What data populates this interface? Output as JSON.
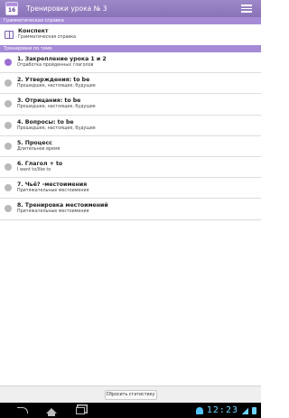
{
  "action_bar": {
    "app_icon_number": "16",
    "title": "Тренировки урока № 3"
  },
  "sections": {
    "grammar_header": "Грамматическая справка",
    "trainings_header": "Тренировки по теме"
  },
  "reference": {
    "title": "Конспект",
    "subtitle": "Грамматическая справка"
  },
  "lessons": [
    {
      "title": "1. Закрепление урока 1 и 2",
      "subtitle": "Отработка пройденных глаголов",
      "active": true
    },
    {
      "title": "2. Утверждения: to be",
      "subtitle": "Прошедшее, настоящее, будущее",
      "active": false
    },
    {
      "title": "3. Отрицания: to be",
      "subtitle": "Прошедшее, настоящее, будущее",
      "active": false
    },
    {
      "title": "4. Вопросы: to be",
      "subtitle": "Прошедшее, настоящее, будущее",
      "active": false
    },
    {
      "title": "5. Процесс",
      "subtitle": "Длительное время",
      "active": false
    },
    {
      "title": "6. Глагол + to",
      "subtitle": "I want to/like to",
      "active": false
    },
    {
      "title": "7. Чьё? -местоимения",
      "subtitle": "Притяжательные местоимения",
      "active": false
    },
    {
      "title": "8. Тренировка местоимений",
      "subtitle": "Притяжательные местоимения",
      "active": false
    }
  ],
  "bottom": {
    "reset_label": "Сбросить статистику"
  },
  "system_bar": {
    "clock": "12:23"
  },
  "colors": {
    "accent": "#a58ad6",
    "active_dot": "#9a6fd4",
    "inactive_dot": "#b9b9b9",
    "clock": "#6fd3ff"
  }
}
